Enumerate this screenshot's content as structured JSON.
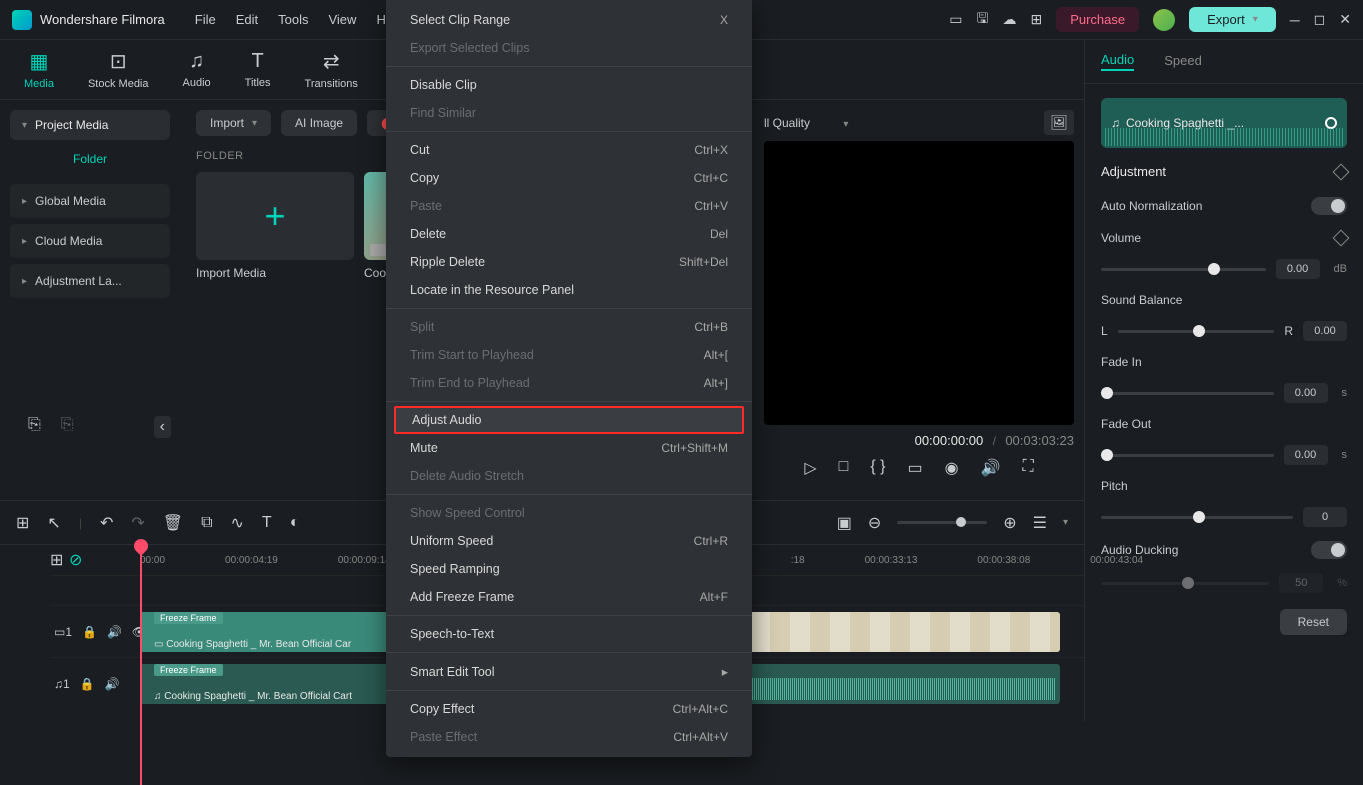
{
  "app": {
    "name": "Wondershare Filmora"
  },
  "menubar": [
    "File",
    "Edit",
    "Tools",
    "View",
    "He"
  ],
  "titlebar": {
    "purchase": "Purchase",
    "export": "Export"
  },
  "tabs": [
    {
      "label": "Media",
      "icon": "▦"
    },
    {
      "label": "Stock Media",
      "icon": "⊡"
    },
    {
      "label": "Audio",
      "icon": "♫"
    },
    {
      "label": "Titles",
      "icon": "T"
    },
    {
      "label": "Transitions",
      "icon": "⇄"
    }
  ],
  "sidebar": {
    "header": "Project Media",
    "folder": "Folder",
    "items": [
      "Global Media",
      "Cloud Media",
      "Adjustment La..."
    ]
  },
  "content": {
    "import": "Import",
    "ai_image": "AI Image",
    "rec": "Rec",
    "folder_label": "FOLDER",
    "cards": [
      {
        "caption": "Import Media"
      },
      {
        "caption": "Cook"
      }
    ]
  },
  "preview": {
    "quality": "ll Quality",
    "time_current": "00:00:00:00",
    "time_total": "00:03:03:23"
  },
  "right_panel": {
    "tabs": [
      "Audio",
      "Speed"
    ],
    "clip_name": "Cooking Spaghetti _...",
    "adjustment": "Adjustment",
    "auto_norm": "Auto Normalization",
    "volume": {
      "label": "Volume",
      "value": "0.00",
      "unit": "dB"
    },
    "balance": {
      "label": "Sound Balance",
      "L": "L",
      "R": "R",
      "value": "0.00"
    },
    "fade_in": {
      "label": "Fade In",
      "value": "0.00",
      "unit": "s"
    },
    "fade_out": {
      "label": "Fade Out",
      "value": "0.00",
      "unit": "s"
    },
    "pitch": {
      "label": "Pitch",
      "value": "0"
    },
    "ducking": {
      "label": "Audio Ducking",
      "value": "50",
      "unit": "%"
    },
    "reset": "Reset"
  },
  "timeline": {
    "ruler": [
      "00:00",
      "00:00:04:19",
      "00:00:09:14",
      ":18",
      "00:00:33:13",
      "00:00:38:08",
      "00:00:43:04"
    ],
    "freeze": "Freeze Frame",
    "clip1": "Cooking Spaghetti _ Mr. Bean Official Car",
    "clip2": "Cooking Spaghetti _ Mr. Bean Official Cart"
  },
  "context_menu": [
    {
      "label": "Select Clip Range",
      "shortcut": "X",
      "disabled": false
    },
    {
      "label": "Export Selected Clips",
      "disabled": true
    },
    {
      "sep": true
    },
    {
      "label": "Disable Clip",
      "disabled": false
    },
    {
      "label": "Find Similar",
      "disabled": true
    },
    {
      "sep": true
    },
    {
      "label": "Cut",
      "shortcut": "Ctrl+X"
    },
    {
      "label": "Copy",
      "shortcut": "Ctrl+C"
    },
    {
      "label": "Paste",
      "shortcut": "Ctrl+V",
      "disabled": true
    },
    {
      "label": "Delete",
      "shortcut": "Del"
    },
    {
      "label": "Ripple Delete",
      "shortcut": "Shift+Del"
    },
    {
      "label": "Locate in the Resource Panel"
    },
    {
      "sep": true
    },
    {
      "label": "Split",
      "shortcut": "Ctrl+B",
      "disabled": true
    },
    {
      "label": "Trim Start to Playhead",
      "shortcut": "Alt+[",
      "disabled": true
    },
    {
      "label": "Trim End to Playhead",
      "shortcut": "Alt+]",
      "disabled": true
    },
    {
      "sep": true
    },
    {
      "label": "Adjust Audio",
      "highlighted": true
    },
    {
      "label": "Mute",
      "shortcut": "Ctrl+Shift+M"
    },
    {
      "label": "Delete Audio Stretch",
      "disabled": true
    },
    {
      "sep": true
    },
    {
      "label": "Show Speed Control",
      "disabled": true
    },
    {
      "label": "Uniform Speed",
      "shortcut": "Ctrl+R"
    },
    {
      "label": "Speed Ramping"
    },
    {
      "label": "Add Freeze Frame",
      "shortcut": "Alt+F"
    },
    {
      "sep": true
    },
    {
      "label": "Speech-to-Text"
    },
    {
      "sep": true
    },
    {
      "label": "Smart Edit Tool",
      "submenu": true
    },
    {
      "sep": true
    },
    {
      "label": "Copy Effect",
      "shortcut": "Ctrl+Alt+C"
    },
    {
      "label": "Paste Effect",
      "shortcut": "Ctrl+Alt+V",
      "disabled": true
    }
  ]
}
